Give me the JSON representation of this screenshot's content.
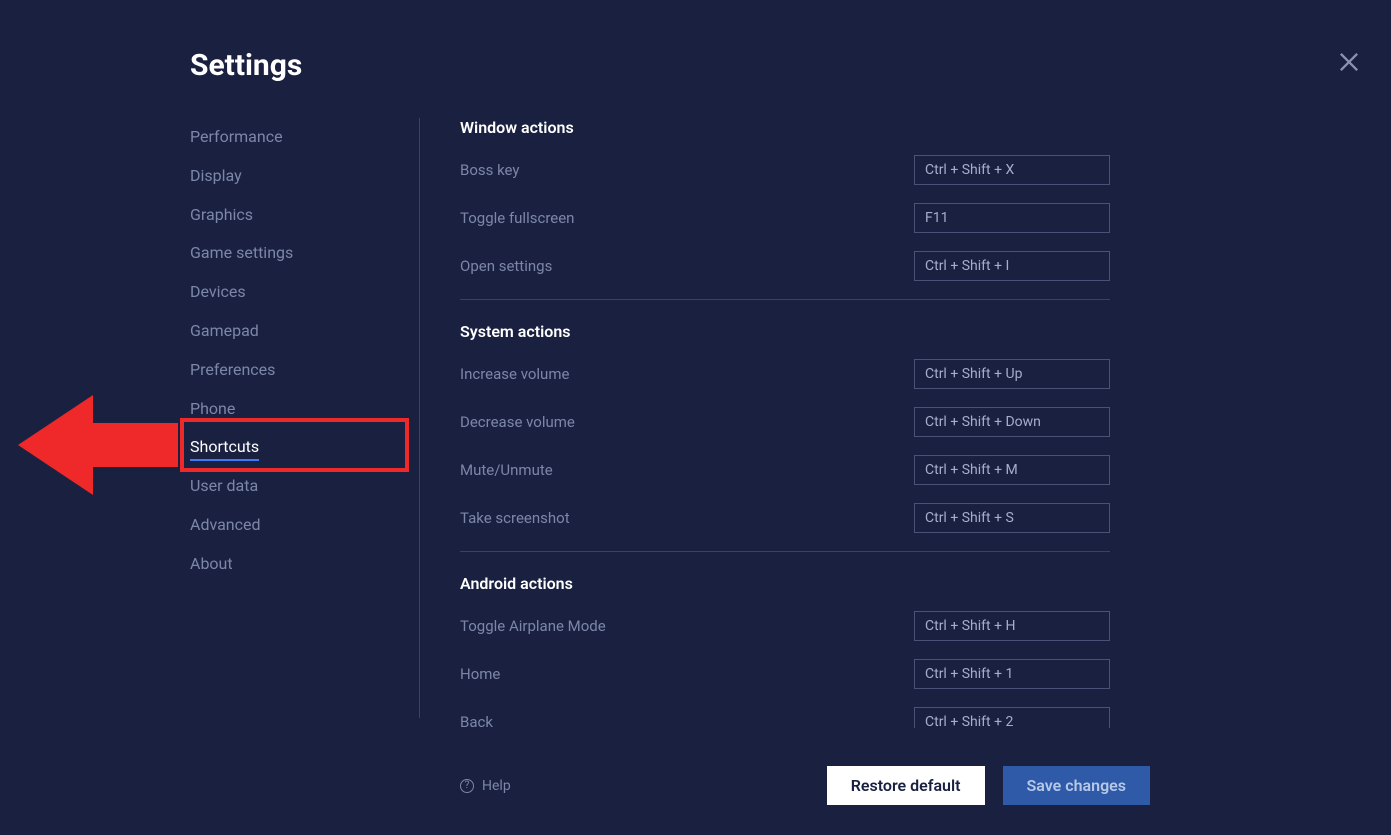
{
  "header": {
    "title": "Settings"
  },
  "sidebar": {
    "items": [
      {
        "label": "Performance",
        "active": false
      },
      {
        "label": "Display",
        "active": false
      },
      {
        "label": "Graphics",
        "active": false
      },
      {
        "label": "Game settings",
        "active": false
      },
      {
        "label": "Devices",
        "active": false
      },
      {
        "label": "Gamepad",
        "active": false
      },
      {
        "label": "Preferences",
        "active": false
      },
      {
        "label": "Phone",
        "active": false
      },
      {
        "label": "Shortcuts",
        "active": true
      },
      {
        "label": "User data",
        "active": false
      },
      {
        "label": "Advanced",
        "active": false
      },
      {
        "label": "About",
        "active": false
      }
    ]
  },
  "sections": [
    {
      "title": "Window actions",
      "shortcuts": [
        {
          "label": "Boss key",
          "value": "Ctrl + Shift + X"
        },
        {
          "label": "Toggle fullscreen",
          "value": "F11"
        },
        {
          "label": "Open settings",
          "value": "Ctrl + Shift + I"
        }
      ]
    },
    {
      "title": "System actions",
      "shortcuts": [
        {
          "label": "Increase volume",
          "value": "Ctrl + Shift + Up"
        },
        {
          "label": "Decrease volume",
          "value": "Ctrl + Shift + Down"
        },
        {
          "label": "Mute/Unmute",
          "value": "Ctrl + Shift + M"
        },
        {
          "label": "Take screenshot",
          "value": "Ctrl + Shift + S"
        }
      ]
    },
    {
      "title": "Android actions",
      "shortcuts": [
        {
          "label": "Toggle Airplane Mode",
          "value": "Ctrl + Shift + H"
        },
        {
          "label": "Home",
          "value": "Ctrl + Shift + 1"
        },
        {
          "label": "Back",
          "value": "Ctrl + Shift + 2"
        }
      ]
    }
  ],
  "footer": {
    "help_label": "Help",
    "restore_label": "Restore default",
    "save_label": "Save changes"
  }
}
